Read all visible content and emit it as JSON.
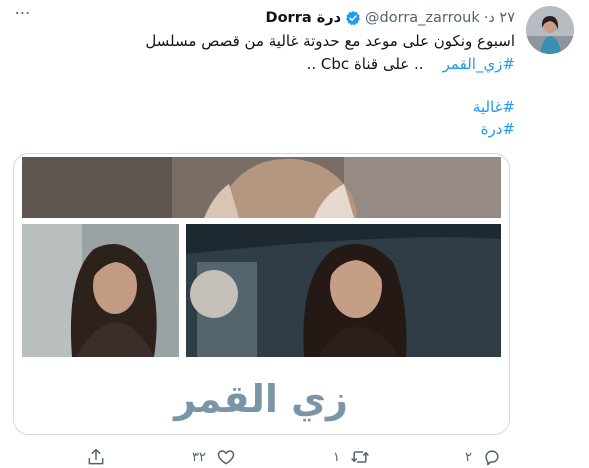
{
  "tweet": {
    "display_name": "درة Dorra",
    "handle": "@dorra_zarrouk",
    "separator": "·",
    "time": "٢٧ د",
    "text_line1": "اسبوع ونكون على موعد مع حدوتة غالية من قصص مسلسل",
    "text_line2_tag": "#زي_القمر",
    "text_line2_rest": ".. على قناة Cbc ..",
    "hashtag_1": "#غالية",
    "hashtag_2": "#درة",
    "more_icon": "⋯"
  },
  "card": {
    "title_art": "زي القمر"
  },
  "actions": {
    "reply_count": "٢",
    "retweet_count": "١",
    "like_count": "٣٢"
  },
  "colors": {
    "link": "#1d9bf0",
    "secondary_text": "#536471",
    "verified": "#1d9bf0",
    "card_border": "#cfd9de",
    "title_art": "#7b95a8"
  }
}
